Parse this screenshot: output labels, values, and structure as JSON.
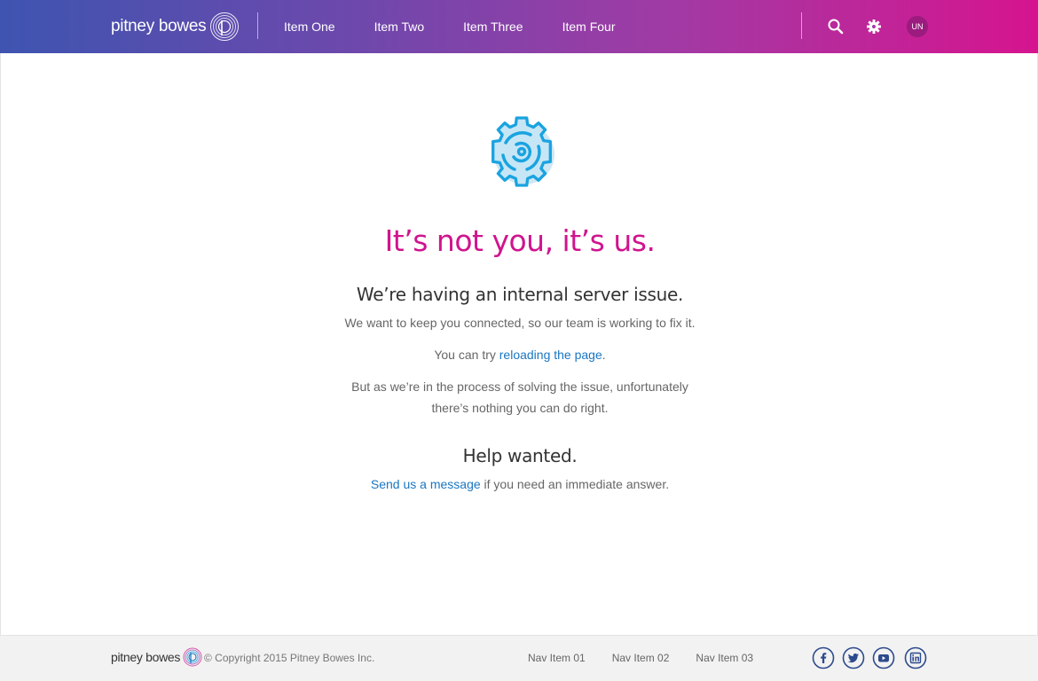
{
  "header": {
    "logo_text": "pitney bowes",
    "nav": [
      {
        "label": "Item One"
      },
      {
        "label": "Item Two"
      },
      {
        "label": "Item Three"
      },
      {
        "label": "Item Four"
      }
    ],
    "icons": {
      "search": "search-icon",
      "settings": "gear-icon"
    },
    "avatar_initials": "UN"
  },
  "main": {
    "icon": "gear-icon",
    "headline": "It’s not you, it’s us.",
    "subhead": "We’re having an internal server issue.",
    "p1": "We want to keep you connected, so our team is working to fix it.",
    "p2_prefix": "You can try ",
    "p2_link": "reloading the page",
    "p2_suffix": ".",
    "p3_line1": "But as we’re in the process of solving the issue, unfortunately",
    "p3_line2": "there’s nothing you can do right.",
    "help_title": "Help wanted.",
    "p4_link": "Send us a message",
    "p4_suffix": " if you need an immediate answer."
  },
  "footer": {
    "logo_text": "pitney bowes",
    "copyright": "© Copyright 2015 Pitney Bowes Inc.",
    "nav": [
      {
        "label": "Nav Item 01"
      },
      {
        "label": "Nav Item 02"
      },
      {
        "label": "Nav Item 03"
      }
    ],
    "social": [
      "facebook-icon",
      "twitter-icon",
      "youtube-icon",
      "linkedin-icon"
    ]
  },
  "colors": {
    "gradient_start": "#3e54b0",
    "gradient_end": "#d6148f",
    "headline": "#d0148e",
    "link": "#1a76c2",
    "icon_blue": "#1aa3e0",
    "footer_icon": "#2c4a8c"
  }
}
